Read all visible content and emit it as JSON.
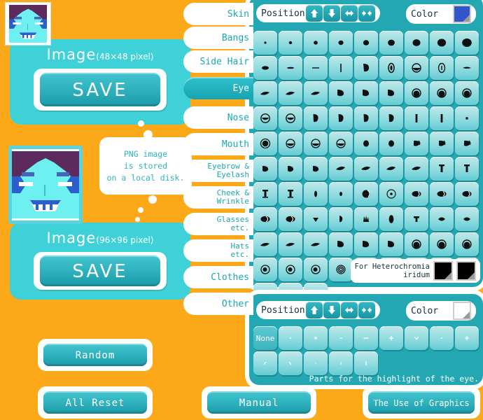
{
  "app": {
    "bg_color": "#FBA919",
    "panel_color": "#23a8b3",
    "accent_color": "#2fb3bf"
  },
  "left": {
    "card48": {
      "title": "Image",
      "subtitle": "(48×48 pixel)",
      "save_label": "SAVE"
    },
    "card96": {
      "title": "Image",
      "subtitle": "(96×96 pixel)",
      "save_label": "SAVE"
    },
    "bubble": {
      "line1": "PNG image",
      "line2": "is stored",
      "line3": "on a local disk."
    }
  },
  "tabs": [
    {
      "label": "Skin",
      "selected": false,
      "two_line": false
    },
    {
      "label": "Bangs",
      "selected": false,
      "two_line": false
    },
    {
      "label": "Side Hair",
      "selected": false,
      "two_line": false
    },
    {
      "label": "Eye",
      "selected": true,
      "two_line": false
    },
    {
      "label": "Nose",
      "selected": false,
      "two_line": false
    },
    {
      "label": "Mouth",
      "selected": false,
      "two_line": false
    },
    {
      "label": "Eyebrow &\nEyelash",
      "selected": false,
      "two_line": true
    },
    {
      "label": "Cheek &\nWrinkle",
      "selected": false,
      "two_line": true
    },
    {
      "label": "Glasses\netc.",
      "selected": false,
      "two_line": true
    },
    {
      "label": "Hats\netc.",
      "selected": false,
      "two_line": true
    },
    {
      "label": "Clothes",
      "selected": false,
      "two_line": false
    },
    {
      "label": "Other",
      "selected": false,
      "two_line": false
    }
  ],
  "eye_panel": {
    "position_label": "Position",
    "position_buttons": [
      "up-arrow",
      "down-arrow",
      "expand-horizontal",
      "contract-horizontal"
    ],
    "position_glyphs": [
      "↑",
      "↓",
      "↔",
      "><"
    ],
    "color_label": "Color",
    "color_value": "#3355cc",
    "grid_columns": 9,
    "grid_rows": 11,
    "tile_count": 93,
    "heterochromia": {
      "line1": "For Heterochromia",
      "line2": "iridum",
      "color_left": "#000000",
      "color_right": "#000000"
    }
  },
  "highlight_panel": {
    "position_label": "Position",
    "position_glyphs": [
      "↑",
      "↓",
      "↔",
      "><"
    ],
    "color_label": "Color",
    "color_value": "#ffffff",
    "none_label": "None",
    "caption": "Parts for the highlight of the eye.",
    "grid_columns": 9,
    "tile_count": 14
  },
  "bottom_buttons": {
    "random": "Random",
    "all_reset": "All Reset",
    "manual": "Manual",
    "graphics": "The Use of Graphics"
  },
  "avatar": {
    "hair_color": "#5c2a5c",
    "skin_color": "#6ef0f0",
    "eye_color": "#3355cc",
    "bg_color": "#6ef0f0"
  }
}
